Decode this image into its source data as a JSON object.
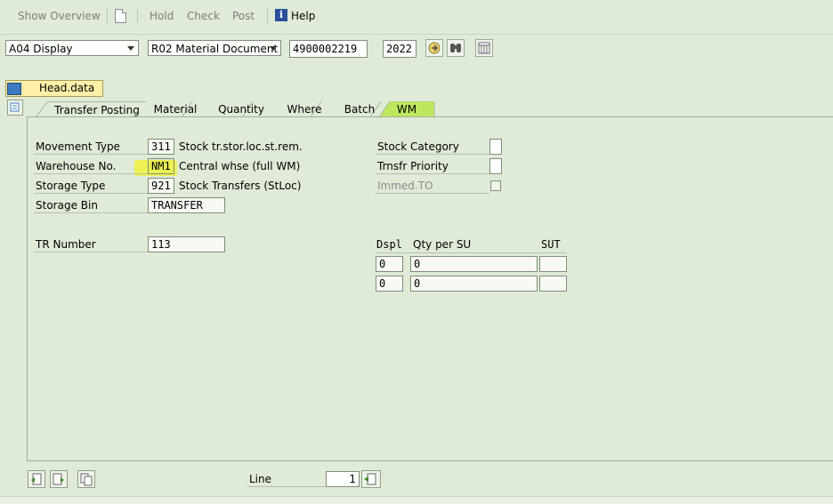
{
  "toolbar": {
    "show_overview": "Show Overview",
    "hold": "Hold",
    "check": "Check",
    "post": "Post",
    "help": "Help"
  },
  "header": {
    "action_combo": "A04 Display",
    "refdoc_combo": "R02 Material Document",
    "document_number": "4900002219",
    "year": "2022"
  },
  "head_data_button": "Head.data",
  "tabs": [
    {
      "label": "Transfer Posting"
    },
    {
      "label": "Material"
    },
    {
      "label": "Quantity"
    },
    {
      "label": "Where"
    },
    {
      "label": "Batch"
    },
    {
      "label": "WM",
      "active": true
    }
  ],
  "wm": {
    "movement_type": {
      "label": "Movement Type",
      "value": "311",
      "text": "Stock tr.stor.loc.st.rem."
    },
    "warehouse_no": {
      "label": "Warehouse No.",
      "value": "NM1",
      "text": "Central whse (full WM)"
    },
    "storage_type": {
      "label": "Storage Type",
      "value": "921",
      "text": "Stock Transfers (StLoc)"
    },
    "storage_bin": {
      "label": "Storage Bin",
      "value": "TRANSFER"
    },
    "tr_number": {
      "label": "TR Number",
      "value": "113"
    },
    "stock_category": {
      "label": "Stock Category"
    },
    "trnsfr_priority": {
      "label": "Trnsfr Priority"
    },
    "immed_to": {
      "label": "Immed.TO"
    },
    "su_table": {
      "headers": [
        "Dspl",
        "Qty per SU",
        "SUT"
      ],
      "rows": [
        {
          "dspl": "0",
          "qty": "0",
          "sut": ""
        },
        {
          "dspl": "0",
          "qty": "0",
          "sut": ""
        }
      ]
    }
  },
  "footer": {
    "line_label": "Line",
    "line_value": "1"
  },
  "colors": {
    "background": "#dfebd7",
    "active_tab": "#bde85e",
    "head_button": "#ffefa8",
    "highlight": "#f0f23a"
  }
}
